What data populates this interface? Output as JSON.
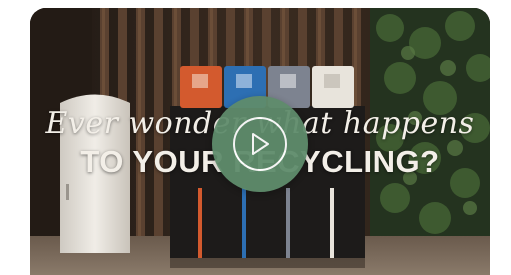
{
  "video": {
    "headline_script": "Ever wonder what happens",
    "headline_caps": "TO YOUR RECYCLING?",
    "play_icon": "play-icon"
  },
  "colors": {
    "play_button": "#5f8c6c",
    "bin_orange": "#d35a2e",
    "bin_blue": "#2d6fb3",
    "bin_grey": "#7d8390",
    "bin_white": "#e8e4dc"
  }
}
